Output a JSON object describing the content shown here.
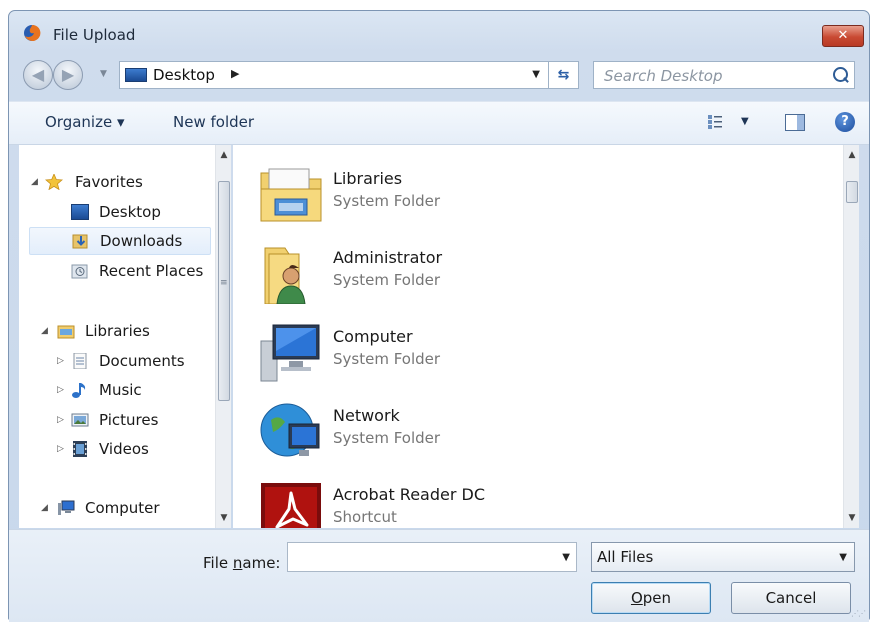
{
  "window": {
    "title": "File Upload",
    "close_glyph": "✕"
  },
  "nav": {
    "back_glyph": "◀",
    "forward_glyph": "▶",
    "address_location": "Desktop",
    "address_separator": "▶",
    "dropdown_glyph": "▼",
    "refresh_glyph": "⇆",
    "search_placeholder": "Search Desktop"
  },
  "toolbar": {
    "organize_label": "Organize ▾",
    "new_folder_label": "New folder"
  },
  "sidebar": {
    "items": [
      {
        "label": "Favorites",
        "icon": "star-icon"
      },
      {
        "label": "Desktop",
        "icon": "desktop-icon"
      },
      {
        "label": "Downloads",
        "icon": "downloads-icon",
        "selected": true
      },
      {
        "label": "Recent Places",
        "icon": "recent-places-icon"
      },
      {
        "label": "Libraries",
        "icon": "libraries-icon"
      },
      {
        "label": "Documents",
        "icon": "documents-icon"
      },
      {
        "label": "Music",
        "icon": "music-icon"
      },
      {
        "label": "Pictures",
        "icon": "pictures-icon"
      },
      {
        "label": "Videos",
        "icon": "videos-icon"
      },
      {
        "label": "Computer",
        "icon": "computer-icon"
      }
    ]
  },
  "files": [
    {
      "name": "Libraries",
      "type": "System Folder",
      "icon": "libraries-folder-icon"
    },
    {
      "name": "Administrator",
      "type": "System Folder",
      "icon": "user-folder-icon"
    },
    {
      "name": "Computer",
      "type": "System Folder",
      "icon": "computer-icon"
    },
    {
      "name": "Network",
      "type": "System Folder",
      "icon": "network-icon"
    },
    {
      "name": "Acrobat Reader DC",
      "type": "Shortcut",
      "icon": "acrobat-icon"
    }
  ],
  "footer": {
    "file_name_label_pre": "File ",
    "file_name_label_u": "n",
    "file_name_label_post": "ame:",
    "file_name_value": "",
    "file_type_filter": "All Files",
    "open_label_u": "O",
    "open_label_post": "pen",
    "cancel_label": "Cancel"
  },
  "colors": {
    "accent": "#2c5fa6",
    "selection": "#e3eefb"
  }
}
